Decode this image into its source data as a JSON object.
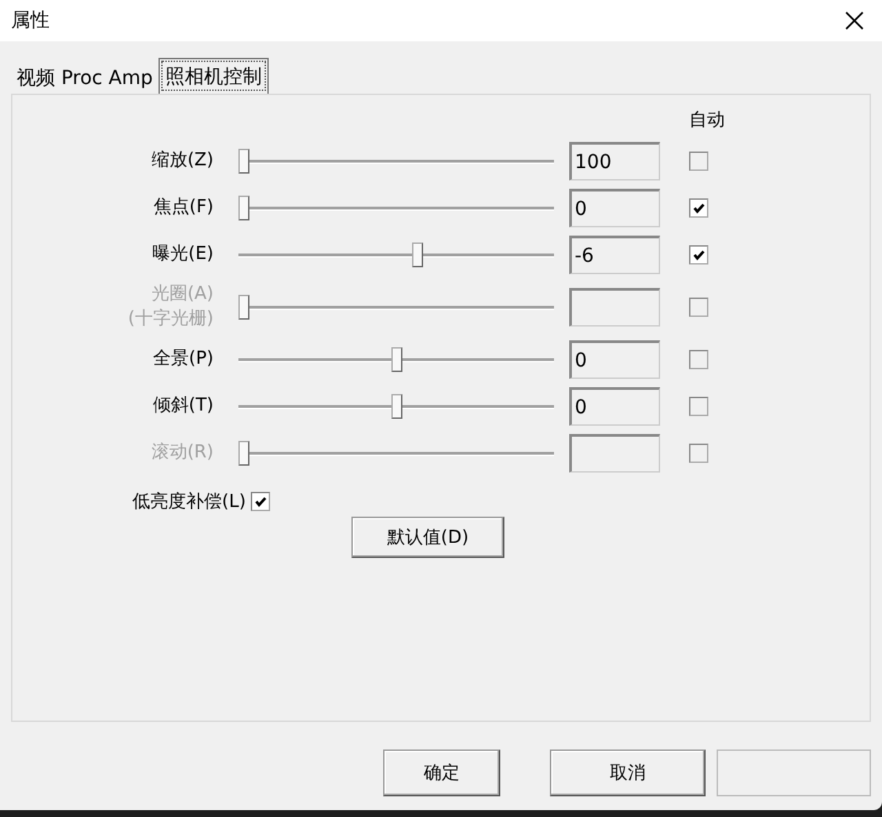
{
  "window": {
    "title": "属性"
  },
  "tabs": [
    {
      "label": "视频 Proc Amp",
      "selected": false
    },
    {
      "label": "照相机控制",
      "selected": true
    }
  ],
  "auto_header": "自动",
  "controls": [
    {
      "label": "缩放(Z)",
      "disabled": false,
      "level": 0,
      "value": "100",
      "auto": false
    },
    {
      "label": "焦点(F)",
      "disabled": false,
      "level": 0,
      "value": "0",
      "auto": true
    },
    {
      "label": "曝光(E)",
      "disabled": false,
      "level": 0.57,
      "value": "-6",
      "auto": true
    },
    {
      "label": "光圈(A)\n(十字光栅)",
      "disabled": true,
      "level": 0,
      "auto": false
    },
    {
      "label": "全景(P)",
      "disabled": false,
      "level": 0.5,
      "value": "0",
      "auto": false
    },
    {
      "label": "倾斜(T)",
      "disabled": false,
      "level": 0.5,
      "value": "0",
      "auto": false
    },
    {
      "label": "滚动(R)",
      "disabled": true,
      "level": 0,
      "auto": false
    }
  ],
  "low_light": {
    "label": "低亮度补偿(L)",
    "checked": true
  },
  "default_button": "默认值(D)",
  "buttons": [
    {
      "label": "确定",
      "disabled": false
    },
    {
      "label": "取消",
      "disabled": false
    },
    {
      "disabled": true
    }
  ]
}
